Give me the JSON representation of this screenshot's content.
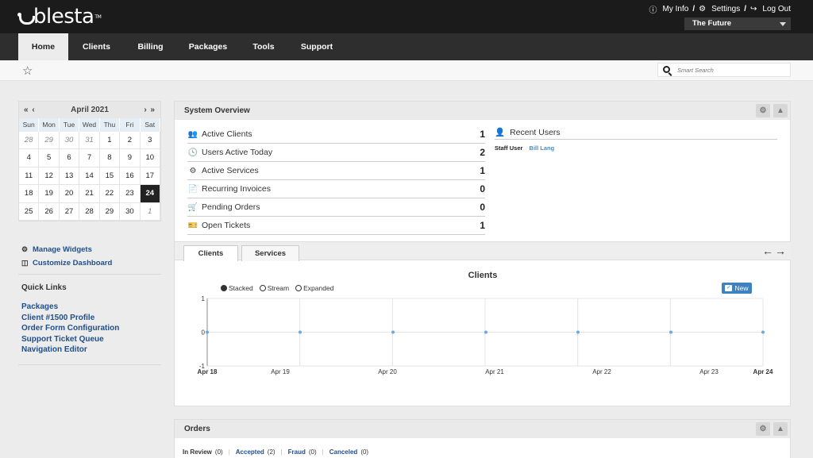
{
  "header": {
    "logo": "blesta",
    "logo_tm": "TM",
    "links": [
      {
        "icon": "info-icon",
        "label": "My Info"
      },
      {
        "icon": "gear-icon",
        "label": "Settings"
      },
      {
        "icon": "logout-icon",
        "label": "Log Out"
      }
    ],
    "separator": "/",
    "company": "The Future"
  },
  "nav": [
    "Home",
    "Clients",
    "Billing",
    "Packages",
    "Tools",
    "Support"
  ],
  "search": {
    "placeholder": "Smart Search"
  },
  "calendar": {
    "month": "April 2021",
    "prev": "« ‹",
    "next": "› »",
    "days_of_week": [
      "Sun",
      "Mon",
      "Tue",
      "Wed",
      "Thu",
      "Fri",
      "Sat"
    ],
    "weeks": [
      [
        "28",
        "29",
        "30",
        "31",
        "1",
        "2",
        "3"
      ],
      [
        "4",
        "5",
        "6",
        "7",
        "8",
        "9",
        "10"
      ],
      [
        "11",
        "12",
        "13",
        "14",
        "15",
        "16",
        "17"
      ],
      [
        "18",
        "19",
        "20",
        "21",
        "22",
        "23",
        "24"
      ],
      [
        "25",
        "26",
        "27",
        "28",
        "29",
        "30",
        "1"
      ]
    ],
    "today": "24"
  },
  "sidebar": {
    "manage_widgets": "Manage Widgets",
    "customize_dashboard": "Customize Dashboard",
    "quick_links_title": "Quick Links",
    "quick_links": [
      "Packages",
      "Client #1500 Profile",
      "Order Form Configuration",
      "Support Ticket Queue",
      "Navigation Editor"
    ]
  },
  "overview": {
    "title": "System Overview",
    "stats": [
      {
        "icon": "users-icon",
        "label": "Active Clients",
        "value": "1"
      },
      {
        "icon": "clock-icon",
        "label": "Users Active Today",
        "value": "2"
      },
      {
        "icon": "cogs-icon",
        "label": "Active Services",
        "value": "1"
      },
      {
        "icon": "document-icon",
        "label": "Recurring Invoices",
        "value": "0"
      },
      {
        "icon": "cart-icon",
        "label": "Pending Orders",
        "value": "0"
      },
      {
        "icon": "ticket-icon",
        "label": "Open Tickets",
        "value": "1"
      }
    ],
    "recent_users_title": "Recent Users",
    "recent_users": [
      {
        "role": "Staff User",
        "name": "Bill Lang"
      }
    ],
    "tabs": [
      "Clients",
      "Services"
    ],
    "chart_title": "Clients",
    "view_options": [
      "Stacked",
      "Stream",
      "Expanded"
    ],
    "selected_view": "Stacked",
    "new_toggle": "New"
  },
  "chart_data": {
    "type": "line",
    "title": "Clients",
    "x": [
      "Apr 18",
      "Apr 19",
      "Apr 20",
      "Apr 21",
      "Apr 22",
      "Apr 23",
      "Apr 24"
    ],
    "series": [
      {
        "name": "New",
        "values": [
          0,
          0,
          0,
          0,
          0,
          0,
          0
        ]
      }
    ],
    "ylim": [
      -1,
      1
    ],
    "yticks": [
      "1",
      "0",
      "-1"
    ],
    "grid": true,
    "color": "#6fa8dc"
  },
  "orders": {
    "title": "Orders",
    "statuses": [
      {
        "label": "In Review",
        "count": "(0)"
      },
      {
        "label": "Accepted",
        "count": "(2)"
      },
      {
        "label": "Fraud",
        "count": "(0)"
      },
      {
        "label": "Canceled",
        "count": "(0)"
      }
    ]
  }
}
